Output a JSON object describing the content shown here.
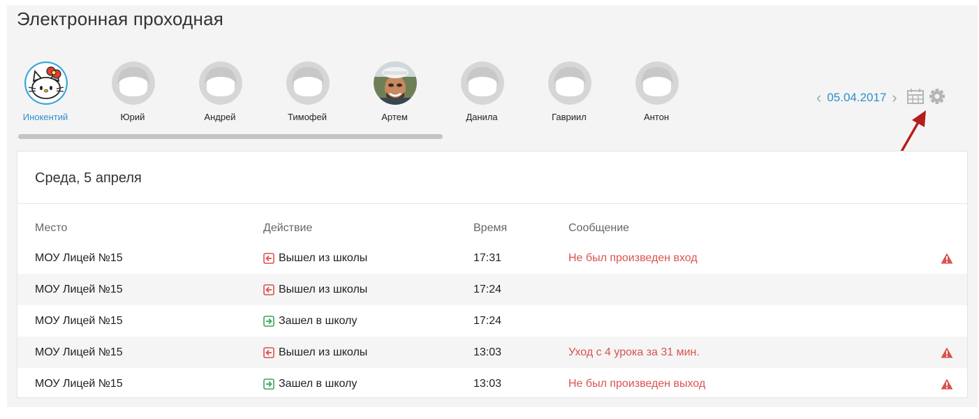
{
  "app": {
    "title": "Электронная проходная"
  },
  "people": [
    {
      "name": "Инокентий",
      "avatar": "hello-kitty-avatar",
      "active": true
    },
    {
      "name": "Юрий",
      "avatar": "default-avatar",
      "active": false
    },
    {
      "name": "Андрей",
      "avatar": "default-avatar",
      "active": false
    },
    {
      "name": "Тимофей",
      "avatar": "default-avatar",
      "active": false
    },
    {
      "name": "Артем",
      "avatar": "photo-avatar",
      "active": false
    },
    {
      "name": "Данила",
      "avatar": "default-avatar",
      "active": false
    },
    {
      "name": "Гавриил",
      "avatar": "default-avatar",
      "active": false
    },
    {
      "name": "Антон",
      "avatar": "default-avatar",
      "active": false
    }
  ],
  "date_nav": {
    "prev": "‹",
    "date": "05.04.2017",
    "next": "›",
    "calendar_icon": "calendar-icon",
    "settings_icon": "gear-icon"
  },
  "day_card": {
    "heading": "Среда, 5 апреля",
    "columns": [
      "Место",
      "Действие",
      "Время",
      "Сообщение"
    ],
    "rows": [
      {
        "place": "МОУ Лицей №15",
        "action": "Вышел из школы",
        "action_type": "exit",
        "time": "17:31",
        "message": "Не был произведен вход",
        "warning": true
      },
      {
        "place": "МОУ Лицей №15",
        "action": "Вышел из школы",
        "action_type": "exit",
        "time": "17:24",
        "message": "",
        "warning": false
      },
      {
        "place": "МОУ Лицей №15",
        "action": "Зашел в школу",
        "action_type": "enter",
        "time": "17:24",
        "message": "",
        "warning": false
      },
      {
        "place": "МОУ Лицей №15",
        "action": "Вышел из школы",
        "action_type": "exit",
        "time": "13:03",
        "message": "Уход с 4 урока за 31 мин.",
        "warning": true
      },
      {
        "place": "МОУ Лицей №15",
        "action": "Зашел в школу",
        "action_type": "enter",
        "time": "13:03",
        "message": "Не был произведен выход",
        "warning": true
      }
    ]
  },
  "colors": {
    "accent": "#2a8fd1",
    "warning": "#d9534f",
    "exit": "#d9534f",
    "enter": "#3aa65a",
    "annotation_arrow": "#b71c1c"
  }
}
